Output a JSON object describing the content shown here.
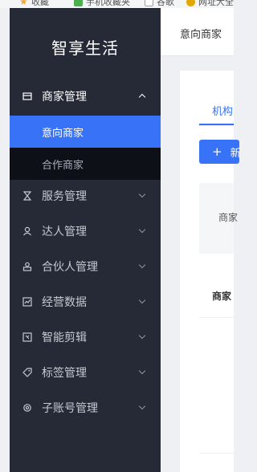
{
  "browser": {
    "bookmarks": [
      {
        "label": "收藏",
        "icon": "star-icon",
        "color": "#f5a623"
      },
      {
        "label": "手机收藏夹",
        "icon": "phone-icon",
        "color": "#4caf50"
      },
      {
        "label": "谷歌",
        "icon": "page-icon",
        "color": "#9e9e9e"
      },
      {
        "label": "网址大全",
        "icon": "globe-icon",
        "color": "#e0a800"
      }
    ]
  },
  "sidebar": {
    "brand": "智享生活",
    "menu": [
      {
        "label": "商家管理",
        "icon": "shop-icon",
        "open": true,
        "children": [
          {
            "label": "意向商家",
            "active": true
          },
          {
            "label": "合作商家",
            "active": false
          }
        ]
      },
      {
        "label": "服务管理",
        "icon": "hourglass-icon"
      },
      {
        "label": "达人管理",
        "icon": "user-icon"
      },
      {
        "label": "合伙人管理",
        "icon": "partner-icon"
      },
      {
        "label": "经营数据",
        "icon": "chart-icon"
      },
      {
        "label": "智能剪辑",
        "icon": "edit-icon"
      },
      {
        "label": "标签管理",
        "icon": "tag-icon"
      },
      {
        "label": "子账号管理",
        "icon": "gear-icon"
      }
    ]
  },
  "topbar": {
    "tab": "意向商家"
  },
  "content": {
    "tab": "机构",
    "add_button": "新",
    "table_header": "商家",
    "row_cell": "商家"
  },
  "colors": {
    "sidebar_bg": "#262a36",
    "active_blue": "#3872f6",
    "submenu_bg": "#0d1017"
  }
}
